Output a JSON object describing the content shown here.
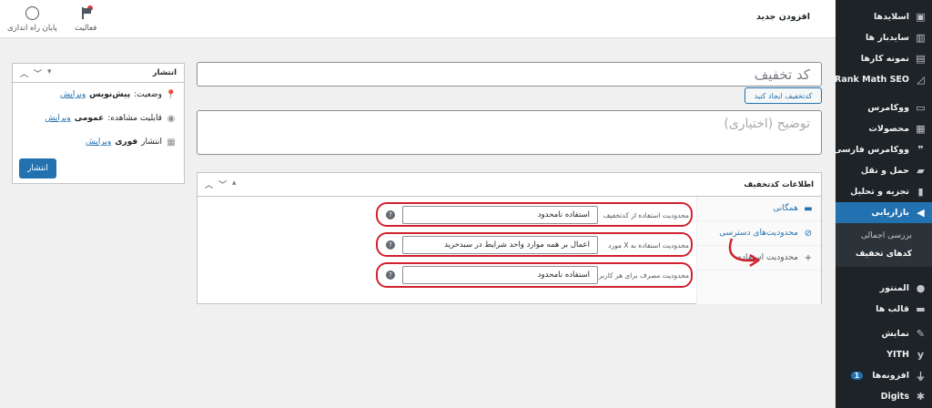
{
  "topbar": {
    "page_heading": "افزودن جدید",
    "activity_label": "فعالیت",
    "finish_setup_label": "پایان راه اندازی"
  },
  "sidebar": {
    "items": [
      {
        "label": "اسلایدها",
        "icon": "slides-icon"
      },
      {
        "label": "ساید‌بار ها",
        "icon": "sidebar-icon"
      },
      {
        "label": "نمونه کارها",
        "icon": "portfolio-icon"
      },
      {
        "label": "Rank Math SEO",
        "icon": "chart-icon"
      },
      {
        "label": "ووکامرس",
        "icon": "woo-icon"
      },
      {
        "label": "محصولات",
        "icon": "products-icon"
      },
      {
        "label": "ووکامرس فارسی",
        "icon": "chat-icon"
      },
      {
        "label": "حمل و نقل",
        "icon": "truck-icon"
      },
      {
        "label": "تجزیه و تحلیل",
        "icon": "analytics-icon"
      },
      {
        "label": "بازاریابی",
        "icon": "megaphone-icon"
      },
      {
        "label": "المنتور",
        "icon": "elementor-icon"
      },
      {
        "label": "قالب ها",
        "icon": "folder-icon"
      },
      {
        "label": "نمایش",
        "icon": "brush-icon"
      },
      {
        "label": "YITH",
        "icon": "yith-icon"
      },
      {
        "label": "افزونه‌ها",
        "icon": "plugin-icon",
        "badge": "1"
      },
      {
        "label": "Digits",
        "icon": "digits-icon"
      }
    ],
    "submenu": {
      "overview": "بررسی اجمالی",
      "coupons": "کدهای تخفیف"
    }
  },
  "editor": {
    "title_placeholder": "کد تخفیف",
    "generate_button": "کدتخفیف ایجاد کنید",
    "description_placeholder": "توضیح (اختیاری)"
  },
  "publish_box": {
    "title": "انتشار",
    "status_label": "وضعیت:",
    "status_value": "پیش‌نویس",
    "visibility_label": "قابلیت مشاهده:",
    "visibility_value": "عمومی",
    "schedule_label": "انتشار",
    "schedule_value": "فوری",
    "edit_link": "ویرایش",
    "publish_button": "انتشار"
  },
  "coupon_data": {
    "title": "اطلاعات کدتخفیف",
    "tabs": [
      {
        "label": "همگانی",
        "icon": "ticket-icon"
      },
      {
        "label": "محدودیت‌های دسترسی",
        "icon": "block-icon"
      },
      {
        "label": "محدودیت استفاده",
        "icon": "plus-icon"
      }
    ],
    "fields": [
      {
        "label": "محدودیت استفاده از کدتخفیف",
        "value": "استفاده نامحدود"
      },
      {
        "label": "محدودیت استفاده به X مورد",
        "value": "اعمال بر همه موارد واحد شرایط در سبدخرید"
      },
      {
        "label": "محدودیت مصرف برای هر کاربر",
        "value": "استفاده نامحدود"
      }
    ]
  },
  "colors": {
    "accent": "#2271b1",
    "sidebar_bg": "#1d2327",
    "annotation": "#d1202f"
  }
}
